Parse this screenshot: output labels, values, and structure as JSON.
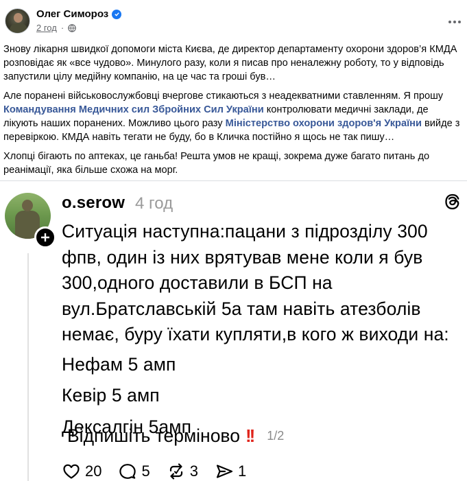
{
  "post": {
    "author": "Олег Симороз",
    "time": "2 год",
    "paragraphs": [
      {
        "text": "Знову лікарня швидкої допомоги міста Києва, де директор департаменту охорони здоров’я КМДА розповідає як «все чудово». Минулого разу, коли я писав про неналежну роботу, то у відповідь запустили цілу медійну компанію, на це час та гроші був…"
      },
      {
        "before": "Але поранені військовослужбовці вчергове стикаються з неадекватними ставленням. Я прошу ",
        "link1": "Командування Медичних сил Збройних Сил України",
        "middle": " контролювати медичні заклади, де лікують наших поранених. Можливо цього разу ",
        "link2": "Міністерство охорони здоров'я України",
        "after": " вийде з перевіркою. КМДА навіть тегати не буду, бо в Кличка постійно я щось не так пишу…"
      },
      {
        "text": "Хлопці бігають по аптеках, це ганьба! Решта умов не кращі, зокрема дуже багато питань до реанімації, яка більше схожа на морг."
      }
    ]
  },
  "thread": {
    "username": "o.serow",
    "time": "4 год",
    "lines": [
      "Ситуація наступна:пацани з підрозділу 300",
      "фпв, один із них врятував мене коли я був",
      "300,одного доставили в БСП на",
      "вул.Братславській 5а там навіть атезболів",
      "немає, буру їхати купляти,в кого ж виходи на:"
    ],
    "items": [
      "Нефам 5 амп",
      "Кевір 5 амп",
      "Дексалгін 5амп"
    ],
    "final": "Відпишіть терміново",
    "final_emoji": "!!",
    "page": "1/2",
    "likes": "20",
    "comments": "5",
    "reposts": "3",
    "shares": "1"
  },
  "colors": {
    "link": "#385898",
    "verified": "#1877f2",
    "meta": "#65676b",
    "exclaim": "#e0251c"
  },
  "icons": [
    "verified-icon",
    "globe-icon",
    "more-icon",
    "plus-icon",
    "threads-logo-icon",
    "heart-icon",
    "comment-icon",
    "repost-icon",
    "share-icon"
  ]
}
